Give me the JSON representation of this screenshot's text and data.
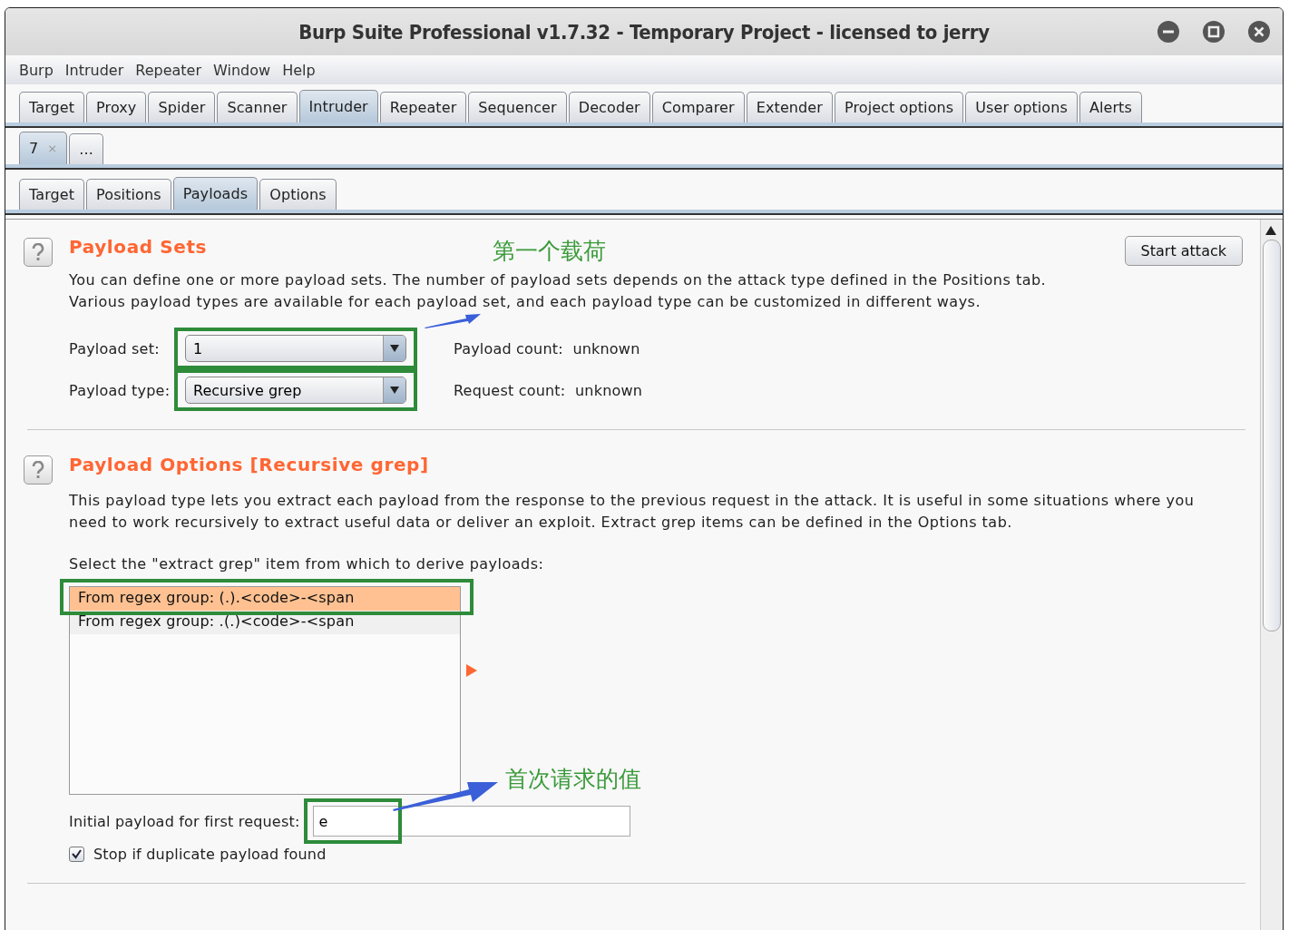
{
  "window": {
    "title": "Burp Suite Professional v1.7.32 - Temporary Project - licensed to jerry"
  },
  "menu": [
    "Burp",
    "Intruder",
    "Repeater",
    "Window",
    "Help"
  ],
  "tabs": [
    {
      "label": "Target",
      "selected": false
    },
    {
      "label": "Proxy",
      "selected": false
    },
    {
      "label": "Spider",
      "selected": false
    },
    {
      "label": "Scanner",
      "selected": false
    },
    {
      "label": "Intruder",
      "selected": true
    },
    {
      "label": "Repeater",
      "selected": false
    },
    {
      "label": "Sequencer",
      "selected": false
    },
    {
      "label": "Decoder",
      "selected": false
    },
    {
      "label": "Comparer",
      "selected": false
    },
    {
      "label": "Extender",
      "selected": false
    },
    {
      "label": "Project options",
      "selected": false
    },
    {
      "label": "User options",
      "selected": false
    },
    {
      "label": "Alerts",
      "selected": false
    }
  ],
  "attack_tabs": [
    {
      "label": "7",
      "close": "×",
      "selected": true
    },
    {
      "label": "...",
      "selected": false
    }
  ],
  "sub_tabs": [
    {
      "label": "Target",
      "selected": false
    },
    {
      "label": "Positions",
      "selected": false
    },
    {
      "label": "Payloads",
      "selected": true
    },
    {
      "label": "Options",
      "selected": false
    }
  ],
  "payload_sets": {
    "title": "Payload Sets",
    "button": "Start attack",
    "description": [
      "You can define one or more payload sets. The number of payload sets depends on the attack type defined in the Positions tab.",
      "Various payload types are available for each payload set, and each payload type can be customized in different ways."
    ],
    "fields": [
      {
        "label": "Payload set:",
        "value": "1",
        "info_label": "Payload count:",
        "info_value": "unknown"
      },
      {
        "label": "Payload type:",
        "value": "Recursive grep",
        "info_label": "Request count:",
        "info_value": "unknown"
      }
    ]
  },
  "payload_options": {
    "title": "Payload Options [Recursive grep]",
    "description": [
      "This payload type lets you extract each payload from the response to the previous request in the attack. It is useful in some situations where you",
      "need to work recursively to extract useful data or deliver an exploit. Extract grep items can be defined in the Options tab."
    ],
    "list_label": "Select the \"extract grep\" item from which to derive payloads:",
    "items": [
      {
        "label": "From regex group: (.).<code>-<span",
        "selected": true
      },
      {
        "label": "From regex group: .(.)<code>-<span",
        "selected": false
      }
    ],
    "initial_label": "Initial payload for first request:",
    "initial_value": "e",
    "checkbox": {
      "label": "Stop if duplicate payload found",
      "checked": true
    }
  },
  "annotations": [
    {
      "text": "第一个载荷"
    },
    {
      "text": "首次请求的值"
    }
  ]
}
